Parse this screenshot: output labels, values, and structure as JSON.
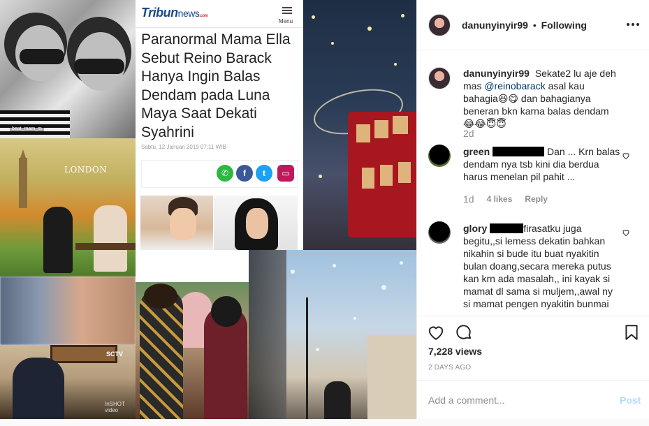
{
  "media": {
    "bw_caption": "beat_mam_m",
    "london_label": "LONDON",
    "tv_logo": "SCTV",
    "tv_watermark": "InSHOT video",
    "article": {
      "brand_main": "Tribun",
      "brand_sub": "news",
      "brand_tld": ".com",
      "menu_label": "Menu",
      "headline": "Paranormal Mama Ella Sebut Reino Barack Hanya Ingin Balas Dendam pada Luna Maya Saat Dekati Syahrini",
      "date": "Sabtu, 12 Januari 2019 07:11 WIB"
    }
  },
  "header": {
    "username": "danunyinyir99",
    "separator": "•",
    "follow_status": "Following"
  },
  "caption": {
    "username": "danunyinyir99",
    "text_1": "Sekate2 lu aje deh mas",
    "mention": "@reinobarack",
    "text_2": "asal kau bahagia😆😋 dan bahagianya beneran bkn karna balas dendam 😂😂😇😇",
    "age": "2d"
  },
  "comments": [
    {
      "username": "green",
      "text": "Dan ... Krn balas dendam nya tsb kini dia berdua harus menelan pil pahit ...",
      "age": "1d",
      "likes": "4 likes",
      "reply": "Reply"
    },
    {
      "username": "glory",
      "text": "firasatku juga begitu,,si lemess dekatin bahkan nikahin si bude itu buat nyakitin bulan doang,secara mereka putus kan krn ada masalah,, ini kayak si mamat dl sama si muljem,,awal ny si mamat pengen nyakitin bunmai"
    }
  ],
  "stats": {
    "views": "7,228 views",
    "posted": "2 DAYS AGO"
  },
  "add_comment": {
    "placeholder": "Add a comment...",
    "post_label": "Post"
  },
  "colors": {
    "text": "#262626",
    "muted": "#8e8e8e",
    "link": "#003569",
    "post_disabled": "#b3dbff",
    "divider": "#efefef"
  }
}
